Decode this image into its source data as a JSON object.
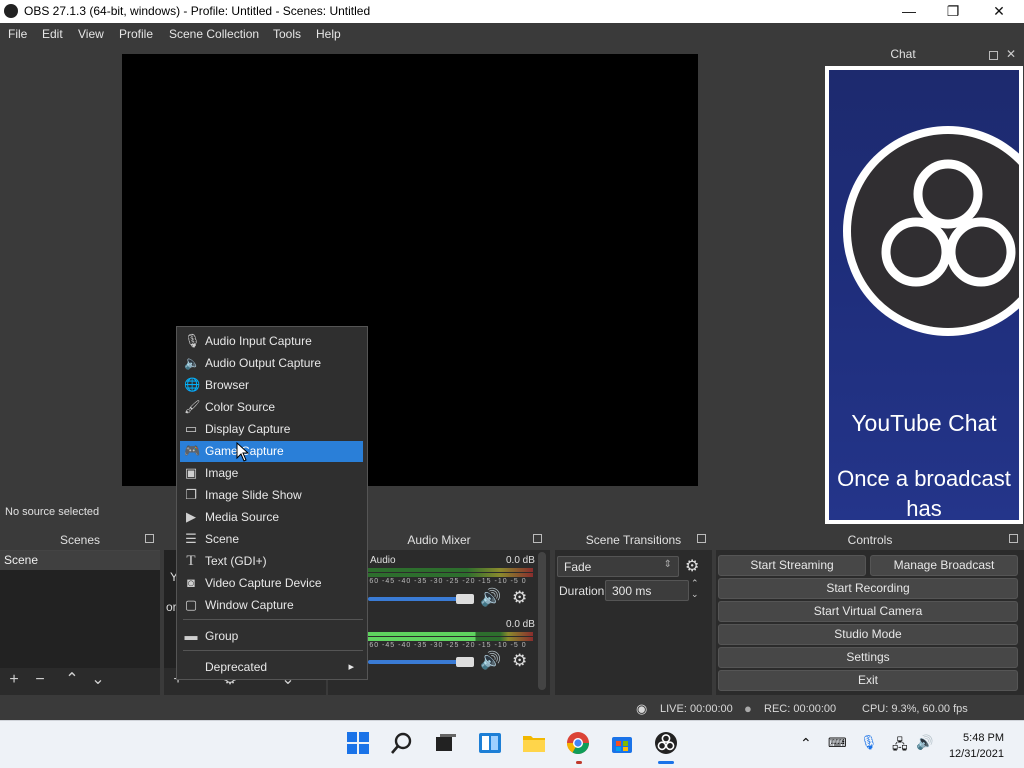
{
  "window": {
    "title": "OBS 27.1.3 (64-bit, windows) - Profile: Untitled - Scenes: Untitled",
    "minimize": "—",
    "maximize": "❐",
    "close": "✕"
  },
  "menu": [
    "File",
    "Edit",
    "View",
    "Profile",
    "Scene Collection",
    "Tools",
    "Help"
  ],
  "status": {
    "no_source": "No source selected"
  },
  "chat": {
    "title": "Chat",
    "text1": "YouTube Chat",
    "text2": "Once a broadcast has"
  },
  "scenes": {
    "title": "Scenes",
    "items": [
      "Scene"
    ]
  },
  "sources": {
    "partial1": "Y",
    "partial2": "or"
  },
  "mixer": {
    "title": "Audio Mixer",
    "channels": [
      {
        "name": "Audio",
        "db": "0.0 dB",
        "level": 0
      },
      {
        "name": "",
        "db": "0.0 dB",
        "level": 0.42
      }
    ],
    "scale": "-60 -45 -40 -35 -30 -25 -20 -15 -10 -5 0"
  },
  "transitions": {
    "title": "Scene Transitions",
    "type": "Fade",
    "duration_label": "Duration",
    "duration": "300 ms"
  },
  "controls": {
    "title": "Controls",
    "start_streaming": "Start Streaming",
    "manage_broadcast": "Manage Broadcast",
    "start_recording": "Start Recording",
    "start_virtual_camera": "Start Virtual Camera",
    "studio_mode": "Studio Mode",
    "settings": "Settings",
    "exit": "Exit"
  },
  "statusbar": {
    "live": "LIVE: 00:00:00",
    "rec": "REC: 00:00:00",
    "cpu": "CPU: 9.3%, 60.00 fps"
  },
  "taskbar": {
    "time": "5:48 PM",
    "date": "12/31/2021"
  },
  "context_menu": {
    "items": [
      {
        "label": "Audio Input Capture",
        "icon": "microphone-icon",
        "glyph": "🎙"
      },
      {
        "label": "Audio Output Capture",
        "icon": "speaker-icon",
        "glyph": "🔈"
      },
      {
        "label": "Browser",
        "icon": "globe-icon",
        "glyph": "🌐"
      },
      {
        "label": "Color Source",
        "icon": "brush-icon",
        "glyph": "🖌"
      },
      {
        "label": "Display Capture",
        "icon": "monitor-icon",
        "glyph": "▭"
      },
      {
        "label": "Game Capture",
        "icon": "gamepad-icon",
        "glyph": "🎮"
      },
      {
        "label": "Image",
        "icon": "image-icon",
        "glyph": "▣"
      },
      {
        "label": "Image Slide Show",
        "icon": "slideshow-icon",
        "glyph": "❐"
      },
      {
        "label": "Media Source",
        "icon": "play-icon",
        "glyph": "▶"
      },
      {
        "label": "Scene",
        "icon": "list-icon",
        "glyph": "☰"
      },
      {
        "label": "Text (GDI+)",
        "icon": "text-icon",
        "glyph": "T"
      },
      {
        "label": "Video Capture Device",
        "icon": "camera-icon",
        "glyph": "◙"
      },
      {
        "label": "Window Capture",
        "icon": "window-icon",
        "glyph": "▢"
      }
    ],
    "group": {
      "label": "Group",
      "icon": "folder-icon",
      "glyph": "▬"
    },
    "deprecated": {
      "label": "Deprecated",
      "arrow": "▸"
    },
    "selected_index": 5
  }
}
